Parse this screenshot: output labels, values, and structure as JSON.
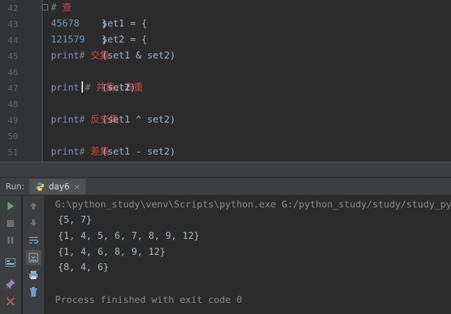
{
  "editor": {
    "lines": [
      {
        "num": "42",
        "tokens": [
          {
            "t": "# ",
            "c": "cm"
          },
          {
            "t": "查",
            "c": "cmz"
          }
        ]
      },
      {
        "num": "43",
        "tokens": [
          {
            "t": "set1 = {",
            "c": "code"
          },
          {
            "t": "4",
            "c": "num"
          },
          {
            "t": ", ",
            "c": "code"
          },
          {
            "t": "5",
            "c": "num"
          },
          {
            "t": ", ",
            "c": "code"
          },
          {
            "t": "6",
            "c": "num"
          },
          {
            "t": ", ",
            "c": "code"
          },
          {
            "t": "7",
            "c": "num"
          },
          {
            "t": ", ",
            "c": "code"
          },
          {
            "t": "8",
            "c": "num"
          },
          {
            "t": "}",
            "c": "code"
          }
        ]
      },
      {
        "num": "44",
        "tokens": [
          {
            "t": "set2 = {",
            "c": "code"
          },
          {
            "t": "12",
            "c": "num"
          },
          {
            "t": ", ",
            "c": "code"
          },
          {
            "t": "1",
            "c": "num"
          },
          {
            "t": ", ",
            "c": "code"
          },
          {
            "t": "5",
            "c": "num"
          },
          {
            "t": ", ",
            "c": "code"
          },
          {
            "t": "7",
            "c": "num"
          },
          {
            "t": ", ",
            "c": "code"
          },
          {
            "t": "9",
            "c": "num"
          },
          {
            "t": "}",
            "c": "code"
          }
        ]
      },
      {
        "num": "45",
        "tokens": [
          {
            "t": "print",
            "c": "kw"
          },
          {
            "t": "(set1 & set2)          ",
            "c": "code"
          },
          {
            "t": "# ",
            "c": "cm"
          },
          {
            "t": "交集",
            "c": "cmz"
          }
        ]
      },
      {
        "num": "46",
        "tokens": []
      },
      {
        "num": "47",
        "tokens": [
          {
            "t": "print",
            "c": "kw"
          },
          {
            "t": "(set1 ",
            "c": "code"
          },
          {
            "t": "|",
            "c": "cursor"
          },
          {
            "t": " set2)          ",
            "c": "code"
          },
          {
            "t": "# ",
            "c": "cm"
          },
          {
            "t": "并集，去重",
            "c": "cmz"
          }
        ]
      },
      {
        "num": "48",
        "tokens": []
      },
      {
        "num": "49",
        "tokens": [
          {
            "t": "print",
            "c": "kw"
          },
          {
            "t": "(set1 ^ set2)          ",
            "c": "code"
          },
          {
            "t": "# ",
            "c": "cm"
          },
          {
            "t": "反交集",
            "c": "cmz"
          }
        ]
      },
      {
        "num": "50",
        "tokens": []
      },
      {
        "num": "51",
        "tokens": [
          {
            "t": "print",
            "c": "kw"
          },
          {
            "t": "(set1 - set2)          ",
            "c": "code"
          },
          {
            "t": "# ",
            "c": "cm"
          },
          {
            "t": "差集",
            "c": "cmz"
          }
        ]
      }
    ]
  },
  "run_panel": {
    "label": "Run:",
    "tab_name": "day6",
    "tab_close": "×"
  },
  "console": {
    "command": "G:\\python_study\\venv\\Scripts\\python.exe G:/python_study/study/study_pyt",
    "outputs": [
      "{5, 7}",
      "{1, 4, 5, 6, 7, 8, 9, 12}",
      "{1, 4, 6, 8, 9, 12}",
      "{8, 4, 6}"
    ],
    "finished": "Process finished with exit code 0"
  },
  "colors": {
    "run_green": "#59a869",
    "stop_gray": "#6e6e6e",
    "close_red": "#c75450",
    "icon_blue": "#6a9fd4"
  }
}
